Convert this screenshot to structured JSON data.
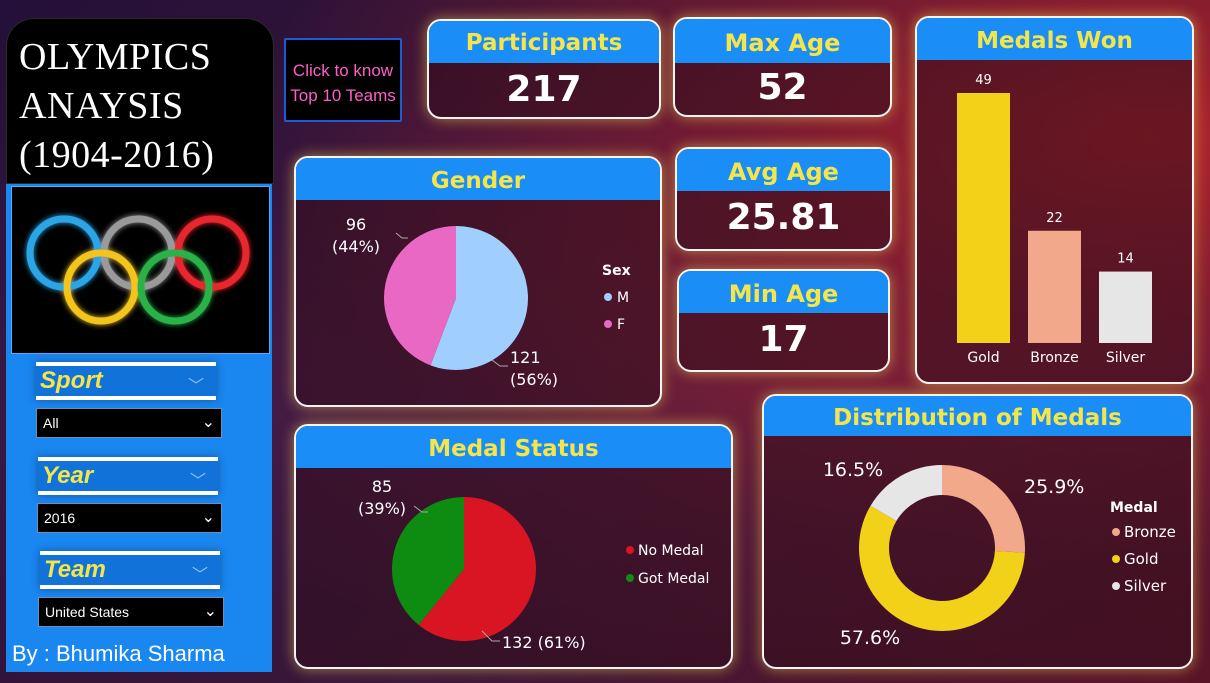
{
  "title": "OLYMPICS\nANAYSIS\n(1904-2016)",
  "nav_button": {
    "line1": "Click to know",
    "line2": "Top 10 Teams"
  },
  "slicers": {
    "sport": {
      "label": "Sport",
      "value": "All"
    },
    "year": {
      "label": "Year",
      "value": "2016"
    },
    "team": {
      "label": "Team",
      "value": "United States"
    }
  },
  "author": "By : Bhumika Sharma",
  "kpis": {
    "participants": {
      "label": "Participants",
      "value": "217"
    },
    "max_age": {
      "label": "Max Age",
      "value": "52"
    },
    "avg_age": {
      "label": "Avg Age",
      "value": "25.81"
    },
    "min_age": {
      "label": "Min Age",
      "value": "17"
    }
  },
  "colors": {
    "accent_blue": "#1a8ef6",
    "title_yellow": "#f4e64a",
    "male": "#a0cffe",
    "female": "#e868c4",
    "no_medal": "#d91524",
    "got_medal": "#0e8c12",
    "gold": "#f2d219",
    "bronze": "#f2a88a",
    "silver": "#e6e6e6"
  },
  "chart_data": [
    {
      "id": "gender",
      "type": "pie",
      "title": "Gender",
      "legend_title": "Sex",
      "legend_position": "right",
      "slices": [
        {
          "name": "M",
          "value": 121,
          "label": "121\n(56%)"
        },
        {
          "name": "F",
          "value": 96,
          "label": "96\n(44%)"
        }
      ]
    },
    {
      "id": "medal_status",
      "type": "pie",
      "title": "Medal Status",
      "legend_position": "right",
      "slices": [
        {
          "name": "No Medal",
          "value": 132,
          "label": "132 (61%)"
        },
        {
          "name": "Got Medal",
          "value": 85,
          "label": "85\n(39%)"
        }
      ]
    },
    {
      "id": "medals_won",
      "type": "bar",
      "title": "Medals Won",
      "categories": [
        "Gold",
        "Bronze",
        "Silver"
      ],
      "values": [
        49,
        22,
        14
      ],
      "grid": false
    },
    {
      "id": "distribution",
      "type": "pie",
      "title": "Distribution of Medals",
      "legend_title": "Medal",
      "legend_position": "right",
      "donut": true,
      "slices": [
        {
          "name": "Bronze",
          "value": 25.9,
          "label": "25.9%"
        },
        {
          "name": "Gold",
          "value": 57.6,
          "label": "57.6%"
        },
        {
          "name": "Silver",
          "value": 16.5,
          "label": "16.5%"
        }
      ]
    }
  ]
}
